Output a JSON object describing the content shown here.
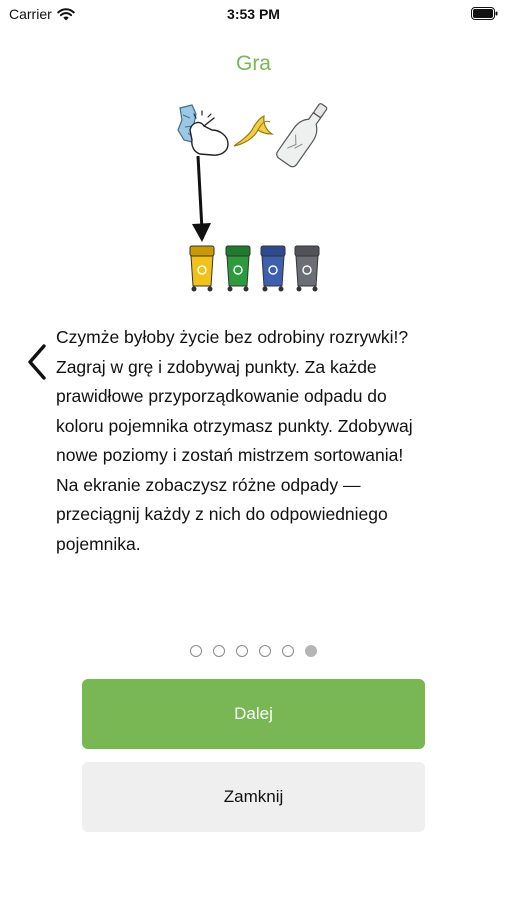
{
  "status_bar": {
    "carrier": "Carrier",
    "time": "3:53 PM",
    "icons": [
      "wifi-icon",
      "battery-icon"
    ]
  },
  "page": {
    "title": "Gra",
    "description": "Czymże byłoby życie bez odrobiny rozrywki!?\nZagraj w grę i zdobywaj punkty. Za każde\nprawidłowe przyporządkowanie odpadu do\nkoloru pojemnika otrzymasz punkty. Zdobywaj\nnowe poziomy i zostań mistrzem sortowania!\nNa ekranie zobaczysz różne odpady —\nprzeciągnij każdy z nich do odpowiedniego\npojemnika."
  },
  "illustration": {
    "items": [
      "crumpled-paper-icon",
      "hand-pointer-icon",
      "banana-peel-icon",
      "glass-bottle-icon",
      "down-arrow-icon"
    ],
    "bins": [
      {
        "name": "yellow-bin-icon",
        "color": "#f2c21a"
      },
      {
        "name": "green-bin-icon",
        "color": "#2e9a3e"
      },
      {
        "name": "blue-bin-icon",
        "color": "#3e5fae"
      },
      {
        "name": "gray-bin-icon",
        "color": "#6b6f75"
      }
    ]
  },
  "pager": {
    "total": 6,
    "current": 6
  },
  "buttons": {
    "next_label": "Dalej",
    "close_label": "Zamknij"
  },
  "colors": {
    "accent": "#78b753",
    "secondary_button": "#efefef",
    "dot_active": "#b5b5b5"
  },
  "icons": {
    "back": "chevron-left-icon"
  }
}
